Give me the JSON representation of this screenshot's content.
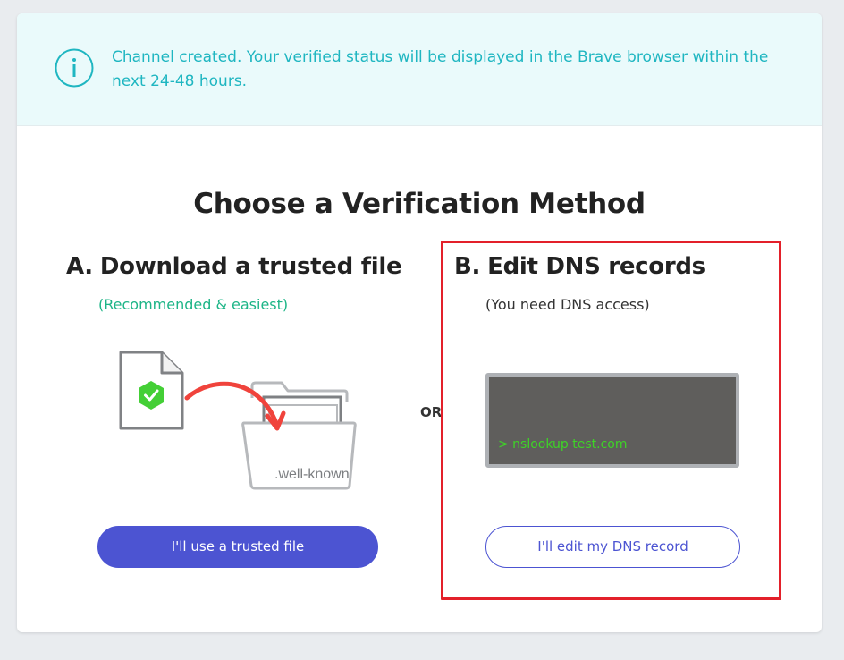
{
  "banner": {
    "message": "Channel created. Your verified status will be displayed in the Brave browser within the next 24-48 hours.",
    "icon": "info-icon",
    "color": "#1fb6c1"
  },
  "page": {
    "title": "Choose a Verification Method",
    "separator": "OR"
  },
  "option_a": {
    "letter": "A.",
    "title": "Download a trusted file",
    "subtitle": "(Recommended & easiest)",
    "folder_label": ".well-known",
    "button_label": "I'll use a trusted file"
  },
  "option_b": {
    "letter": "B.",
    "title": "Edit DNS records",
    "subtitle": "(You need DNS access)",
    "terminal_text": "> nslookup test.com",
    "button_label": "I'll edit my DNS record"
  },
  "colors": {
    "accent": "#4c54d2",
    "success": "#1db587",
    "highlight": "#e3202a"
  }
}
